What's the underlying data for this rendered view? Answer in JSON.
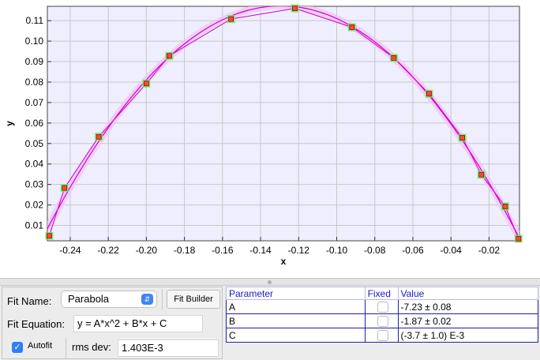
{
  "chart_data": {
    "type": "scatter",
    "xlabel": "x",
    "ylabel": "y",
    "xlim": [
      -0.252,
      -0.004
    ],
    "ylim": [
      0.0025,
      0.117
    ],
    "x_ticks": [
      "-0.24",
      "-0.22",
      "-0.20",
      "-0.18",
      "-0.16",
      "-0.14",
      "-0.12",
      "-0.10",
      "-0.08",
      "-0.06",
      "-0.04",
      "-0.02"
    ],
    "x_tick_values": [
      -0.24,
      -0.22,
      -0.2,
      -0.18,
      -0.16,
      -0.14,
      -0.12,
      -0.1,
      -0.08,
      -0.06,
      -0.04,
      -0.02
    ],
    "y_ticks": [
      "0.01",
      "0.02",
      "0.03",
      "0.04",
      "0.05",
      "0.06",
      "0.07",
      "0.08",
      "0.09",
      "0.10",
      "0.11"
    ],
    "y_tick_values": [
      0.01,
      0.02,
      0.03,
      0.04,
      0.05,
      0.06,
      0.07,
      0.08,
      0.09,
      0.1,
      0.11
    ],
    "grid": true,
    "series": [
      {
        "x": [
          -0.251,
          -0.243,
          -0.225,
          -0.2,
          -0.188,
          -0.1555,
          -0.122,
          -0.092,
          -0.07,
          -0.0515,
          -0.034,
          -0.024,
          -0.0115,
          -0.0045
        ],
        "y": [
          0.0049,
          0.0283,
          0.0533,
          0.0793,
          0.0928,
          0.1108,
          0.116,
          0.1068,
          0.0918,
          0.0743,
          0.0528,
          0.0348,
          0.0193,
          0.0035
        ]
      }
    ],
    "fit": {
      "A": -7.23,
      "B": -1.87,
      "C": -0.0037
    },
    "colors": {
      "fit_line": "#cc00cc",
      "marker_fill": "#ff4444",
      "marker_halo": "#66ee55",
      "band": "#f4c6f4"
    }
  },
  "fit_panel": {
    "fit_name_label": "Fit Name:",
    "fit_name_value": "Parabola",
    "fit_builder_label": "Fit Builder",
    "equation_label": "Fit Equation:",
    "equation_value": "y = A*x^2 + B*x + C",
    "autofit_label": "Autofit",
    "autofit_checked": true,
    "rms_label": "rms dev:",
    "rms_value": "1.403E-3"
  },
  "param_table": {
    "headers": {
      "parameter": "Parameter",
      "fixed": "Fixed",
      "value": "Value"
    },
    "rows": [
      {
        "name": "A",
        "value": "-7.23 ± 0.08"
      },
      {
        "name": "B",
        "value": "-1.87 ± 0.02"
      },
      {
        "name": "C",
        "value": "(-3.7 ± 1.0) E-3"
      }
    ]
  }
}
